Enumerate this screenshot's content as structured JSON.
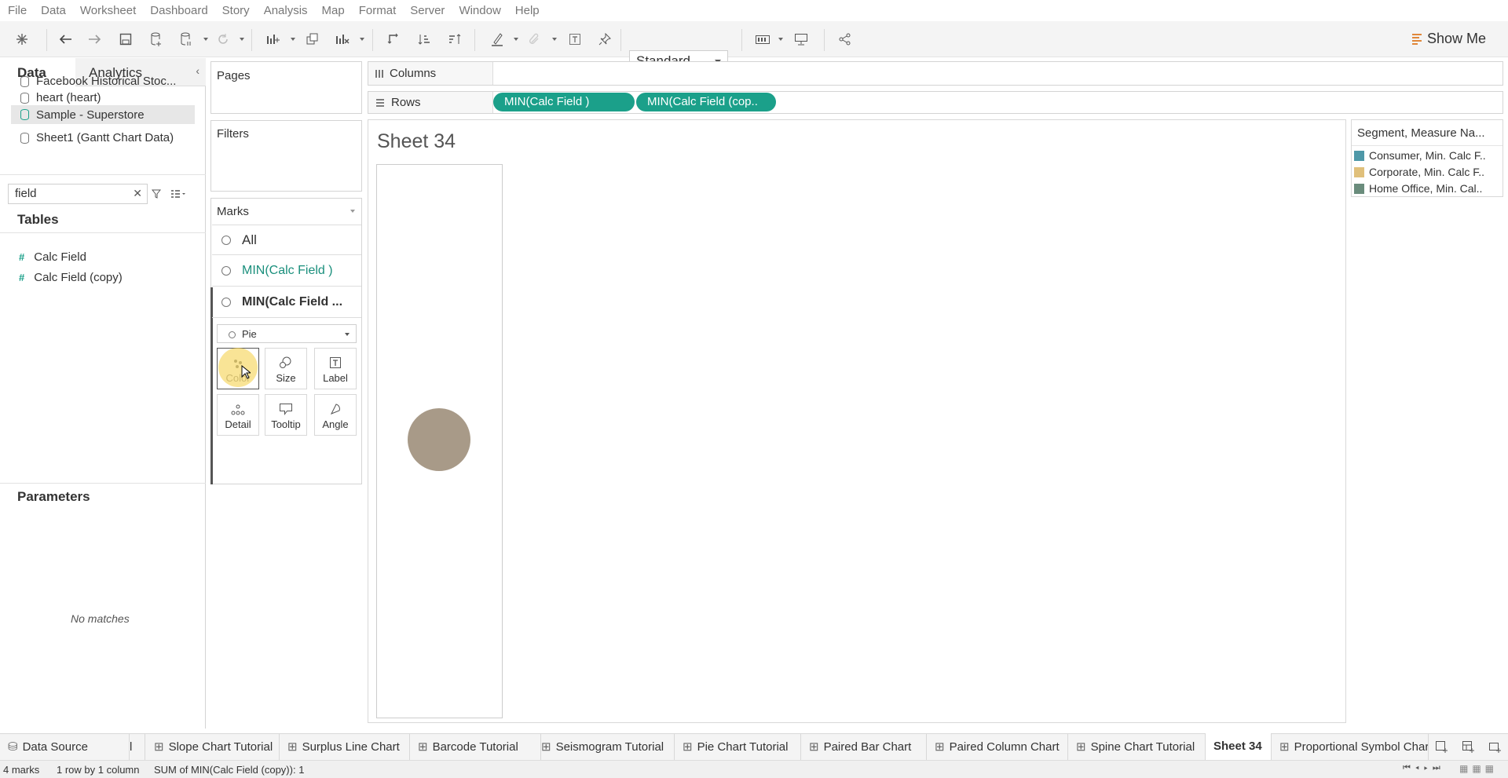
{
  "menu": [
    "File",
    "Data",
    "Worksheet",
    "Dashboard",
    "Story",
    "Analysis",
    "Map",
    "Format",
    "Server",
    "Window",
    "Help"
  ],
  "toolbar": {
    "standard_label": "Standard",
    "show_me_label": "Show Me"
  },
  "left": {
    "tab_data": "Data",
    "tab_analytics": "Analytics",
    "datasources": [
      "Facebook Historical Stoc...",
      "heart (heart)",
      "Sample - Superstore",
      "Sheet1 (Gantt Chart Data)"
    ],
    "search_value": "field",
    "tables_title": "Tables",
    "fields": [
      "Calc Field",
      "Calc Field  (copy)"
    ],
    "parameters_title": "Parameters",
    "no_matches": "No matches"
  },
  "shelves": {
    "pages": "Pages",
    "filters": "Filters",
    "marks": "Marks",
    "columns": "Columns",
    "rows": "Rows"
  },
  "marks": {
    "all": "All",
    "card1": "MIN(Calc Field )",
    "card2": "MIN(Calc Field ...",
    "mark_type": "Pie",
    "buttons": [
      "Color",
      "Size",
      "Label",
      "Detail",
      "Tooltip",
      "Angle"
    ]
  },
  "pills": [
    "MIN(Calc Field )",
    "MIN(Calc Field  (cop.."
  ],
  "view": {
    "sheet_title": "Sheet 34",
    "pie_color": "#a89a88"
  },
  "legend": {
    "title": "Segment, Measure Na...",
    "items": [
      {
        "label": "Consumer, Min. Calc F..",
        "color": "#4e98a8"
      },
      {
        "label": "Corporate, Min. Calc F..",
        "color": "#e0c07b"
      },
      {
        "label": "Home Office, Min. Cal..",
        "color": "#6a8c7c"
      }
    ]
  },
  "sheet_tabs": [
    "Data Source",
    "l",
    "Slope Chart Tutorial",
    "Surplus Line Chart",
    "Barcode Tutorial",
    "Seismogram Tutorial",
    "Pie Chart Tutorial",
    "Paired Bar Chart",
    "Paired Column Chart",
    "Spine Chart Tutorial",
    "Sheet 34",
    "Proportional Symbol Char"
  ],
  "status": {
    "marks": "4 marks",
    "rows": "1 row by 1 column",
    "sum": "SUM of MIN(Calc Field  (copy)): 1"
  }
}
